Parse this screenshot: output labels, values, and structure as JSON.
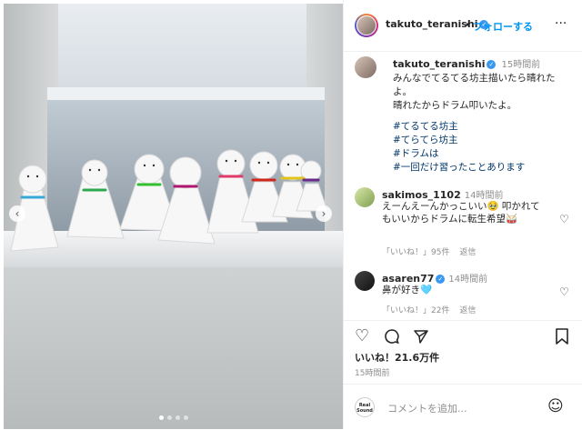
{
  "header": {
    "username": "takuto_teranishi",
    "follow_sep": "•",
    "follow_label": "フォローする",
    "more": "···"
  },
  "caption": {
    "username": "takuto_teranishi",
    "time": "15時間前",
    "lines": [
      "みんなでてるてる坊主描いたら晴れたよ。",
      "晴れたからドラム叩いたよ。"
    ],
    "tags": [
      "#てるてる坊主",
      "#てらてら坊主",
      "#ドラムは",
      "#一回だけ習ったことあります"
    ]
  },
  "comments": [
    {
      "username": "sakimos_1102",
      "time": "14時間前",
      "text": "えーんえーんかっこいい🥹 叩かれてもいいからドラムに転生希望🥁",
      "likes": "「いいね！」95件",
      "reply": "返信"
    },
    {
      "username": "asaren77",
      "time": "14時間前",
      "text": "鼻が好き🩵",
      "likes": "「いいね！」22件",
      "reply": "返信"
    }
  ],
  "actions": {
    "likes": "いいね！21.6万件",
    "posted": "15時間前"
  },
  "composer": {
    "placeholder": "コメントを追加...",
    "realsound": "Real Sound"
  },
  "media": {
    "slides": 4,
    "active_slide": 1
  },
  "icons": {
    "heart": "heart-icon",
    "comment": "comment-icon",
    "share": "share-icon",
    "save": "bookmark-icon",
    "emoji": "emoji-icon",
    "prev": "chevron-left-icon",
    "next": "chevron-right-icon"
  },
  "colors": {
    "accent": "#0095f6",
    "verified": "#3897f0",
    "tag": "#00376b",
    "muted": "#8e8e8e"
  }
}
